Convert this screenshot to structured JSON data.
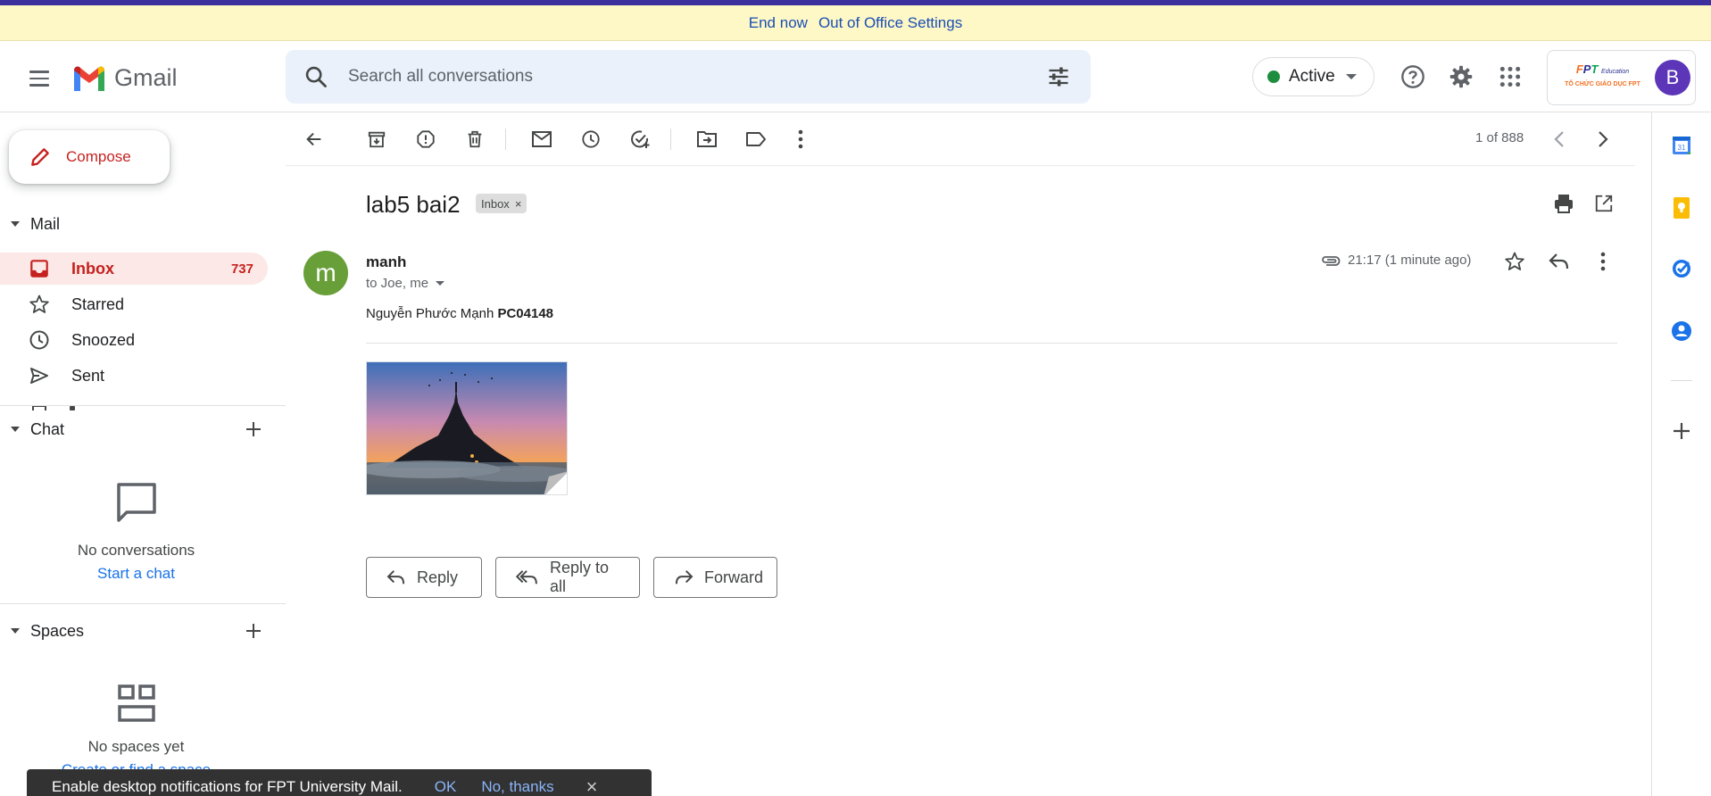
{
  "banner": {
    "end_now": "End now",
    "settings": "Out of Office Settings"
  },
  "app": {
    "name": "Gmail"
  },
  "search": {
    "placeholder": "Search all conversations",
    "value": ""
  },
  "status": {
    "label": "Active",
    "color": "#1e8e3e"
  },
  "account": {
    "org_logo_text": [
      "FPT",
      "Education"
    ],
    "org_subtitle": "TỔ CHỨC GIÁO DỤC FPT",
    "avatar_letter": "B"
  },
  "sidebar": {
    "compose_label": "Compose",
    "mail_section": "Mail",
    "items": [
      {
        "label": "Inbox",
        "count": "737",
        "icon": "inbox-icon"
      },
      {
        "label": "Starred",
        "icon": "star-icon"
      },
      {
        "label": "Snoozed",
        "icon": "clock-icon"
      },
      {
        "label": "Sent",
        "icon": "send-icon"
      }
    ],
    "chat_section": "Chat",
    "chat_empty": "No conversations",
    "chat_link": "Start a chat",
    "spaces_section": "Spaces",
    "spaces_empty": "No spaces yet",
    "spaces_link": "Create or find a space"
  },
  "toolbar": {
    "pager": "1 of 888"
  },
  "message": {
    "subject": "lab5 bai2",
    "label_chip": "Inbox",
    "label_chip_close": "×",
    "sender_initial": "m",
    "sender_name": "manh",
    "to_line": "to Joe, me",
    "time": "21:17 (1 minute ago)",
    "body_prefix": "Nguyễn Phước Mạnh",
    "body_bold": "PC04148"
  },
  "actions": {
    "reply": "Reply",
    "reply_all": "Reply to all",
    "forward": "Forward"
  },
  "snackbar": {
    "text": "Enable desktop notifications for FPT University Mail.",
    "ok": "OK",
    "no": "No, thanks",
    "close": "×"
  },
  "colors": {
    "accent": "#c5221f",
    "active_row": "#fce8e6",
    "link": "#1a73e8",
    "avatar_sender": "#689f38",
    "avatar_account": "#5c35b8"
  }
}
